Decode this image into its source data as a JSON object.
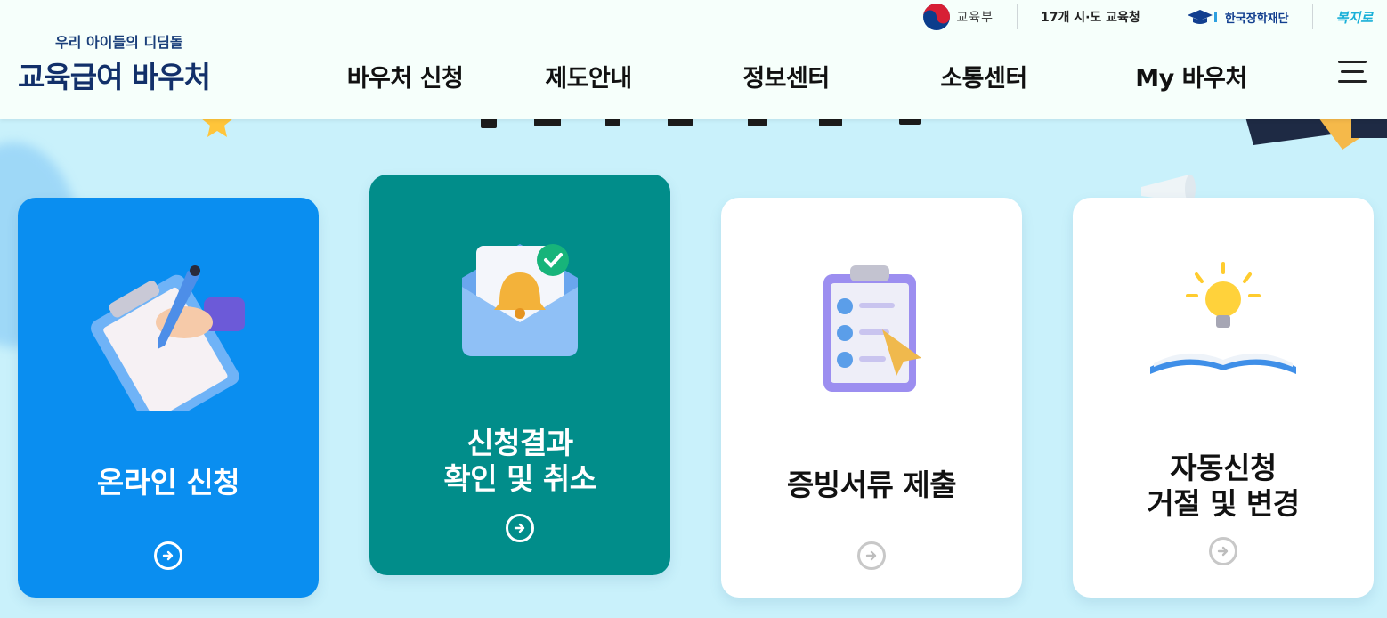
{
  "header": {
    "logo_tagline": "우리 아이들의 디딤돌",
    "logo_title": "교육급여 바우처",
    "util_links": {
      "moe": "교육부",
      "city": "17개 시·도 교육청",
      "kosaf": "한국장학재단",
      "bokjiro": "복지로"
    },
    "nav": [
      "바우처 신청",
      "제도안내",
      "정보센터",
      "소통센터",
      "My 바우처"
    ]
  },
  "cards": [
    {
      "lines": [
        "온라인 신청"
      ],
      "color": "#0a8ef0",
      "icon": "clipboard-pen-icon"
    },
    {
      "lines": [
        "신청결과",
        "확인 및 취소"
      ],
      "color": "#018d8a",
      "icon": "envelope-bell-icon"
    },
    {
      "lines": [
        "증빙서류 제출"
      ],
      "color": "#ffffff",
      "icon": "checklist-clipboard-icon"
    },
    {
      "lines": [
        "자동신청",
        "거절 및 변경"
      ],
      "color": "#ffffff",
      "icon": "book-lightbulb-icon"
    }
  ],
  "colors": {
    "page_bg": "#c9f1fb",
    "header_bg": "#f6fffb",
    "brand_navy": "#12306a",
    "card_blue": "#0a8ef0",
    "card_teal": "#018d8a"
  }
}
